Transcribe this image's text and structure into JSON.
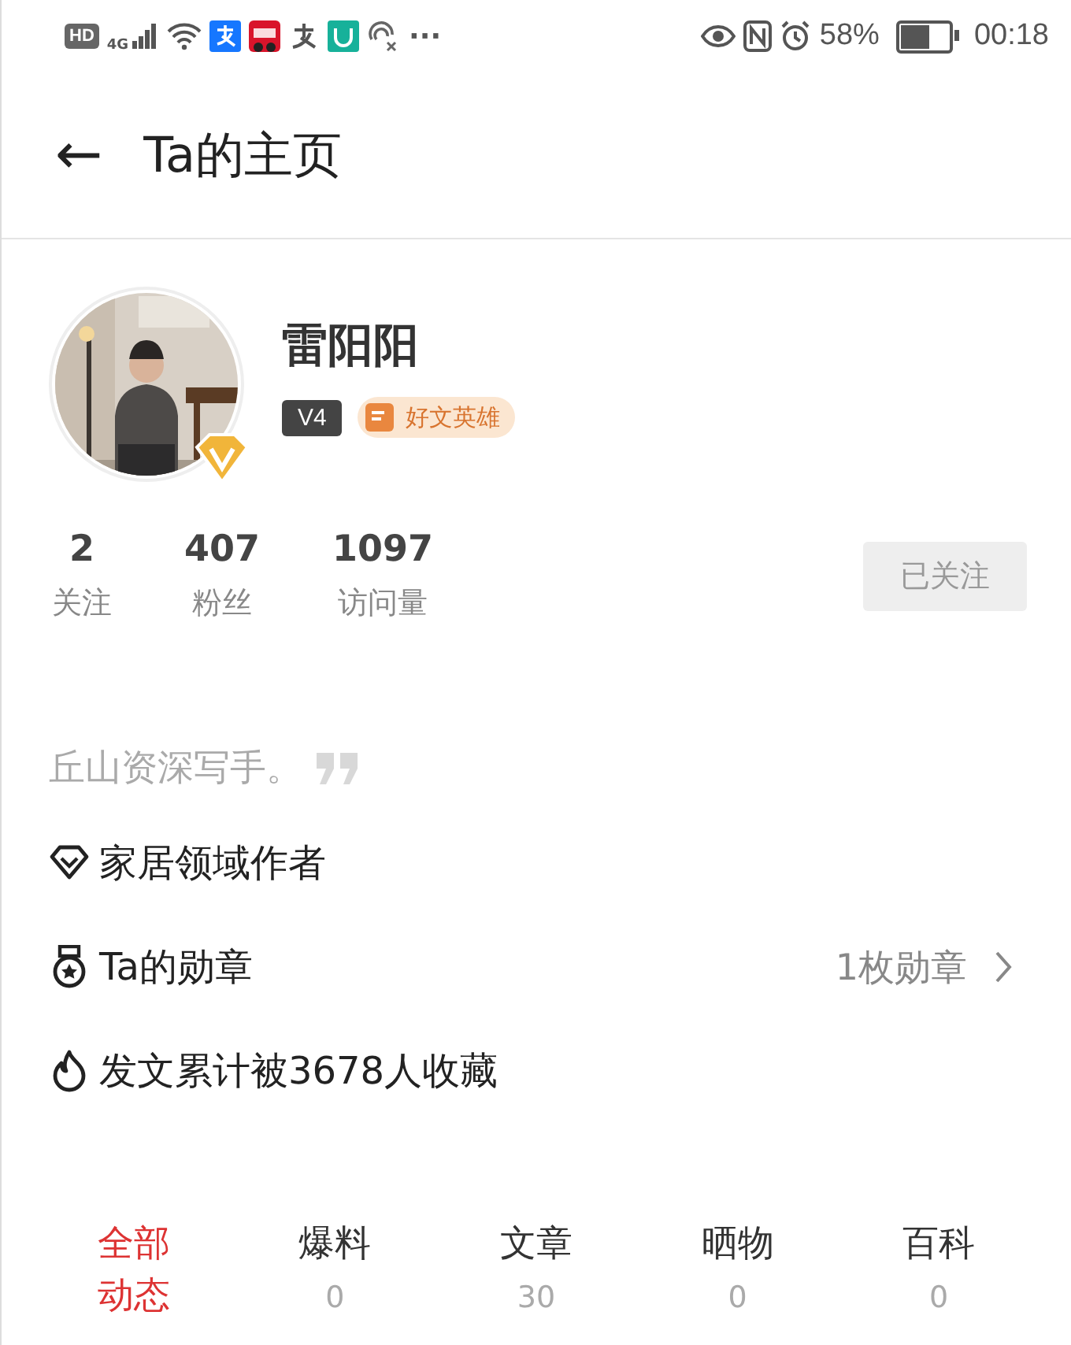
{
  "status_bar": {
    "hd": "HD",
    "network": "4G",
    "more": "···",
    "battery_percent": "58%",
    "time": "00:18"
  },
  "header": {
    "back": "←",
    "title": "Ta的主页"
  },
  "profile": {
    "verified": true,
    "name": "雷阳阳",
    "level": "V4",
    "badge": "好文英雄"
  },
  "stats": [
    {
      "value": "2",
      "label": "关注"
    },
    {
      "value": "407",
      "label": "粉丝"
    },
    {
      "value": "1097",
      "label": "访问量"
    }
  ],
  "follow_button": {
    "label": "已关注",
    "selected": true
  },
  "bio": "丘山资深写手。",
  "info_rows": [
    {
      "kind": "domain",
      "text": "家居领域作者"
    },
    {
      "kind": "medal",
      "text": "Ta的勋章",
      "value": "1枚勋章"
    },
    {
      "kind": "fire",
      "text": "发文累计被3678人收藏"
    }
  ],
  "tabs": [
    {
      "label": "全部动态",
      "selected": true
    },
    {
      "label": "爆料",
      "count": "0",
      "selected": false
    },
    {
      "label": "文章",
      "count": "30",
      "selected": false
    },
    {
      "label": "晒物",
      "count": "0",
      "selected": false
    },
    {
      "label": "百科",
      "count": "0",
      "selected": false
    }
  ]
}
